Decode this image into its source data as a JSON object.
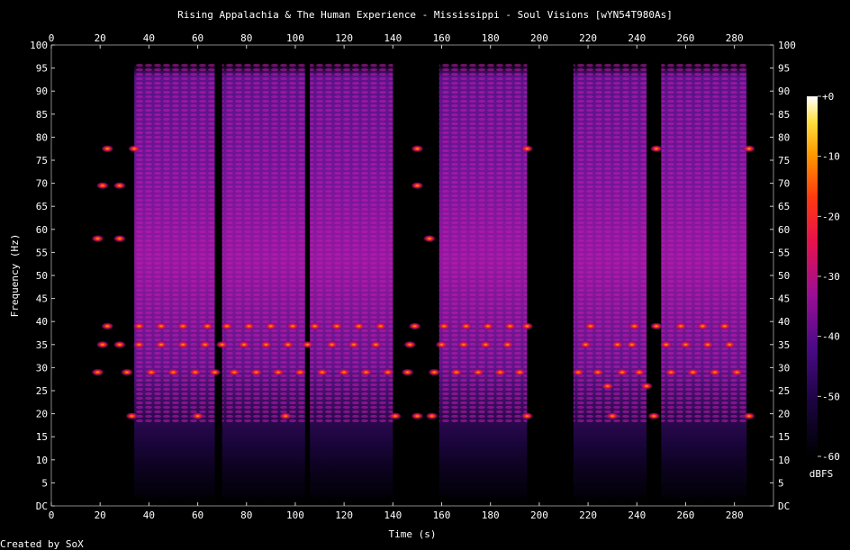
{
  "chart_data": {
    "type": "heatmap",
    "title": "Rising Appalachia & The Human Experience - Mississippi - Soul Visions [wYN54T980As]",
    "xlabel": "Time (s)",
    "ylabel": "Frequency (Hz)",
    "xlim": [
      0,
      296
    ],
    "ylim": [
      0,
      100
    ],
    "x_ticks": [
      "0",
      "20",
      "40",
      "60",
      "80",
      "100",
      "120",
      "140",
      "160",
      "180",
      "200",
      "220",
      "240",
      "260",
      "280"
    ],
    "y_ticks": [
      "DC",
      "5",
      "10",
      "15",
      "20",
      "25",
      "30",
      "35",
      "40",
      "45",
      "50",
      "55",
      "60",
      "65",
      "70",
      "75",
      "80",
      "85",
      "90",
      "95",
      "100"
    ],
    "colorbar": {
      "label": "dBFS",
      "ticks": [
        "+0",
        "-10",
        "-20",
        "-30",
        "-40",
        "-50",
        "-60"
      ],
      "range": [
        -60,
        0
      ]
    },
    "footer": "Created by SoX",
    "dense_segments": [
      [
        34,
        67
      ],
      [
        70,
        104
      ],
      [
        106,
        140
      ],
      [
        159,
        195
      ],
      [
        214,
        244
      ],
      [
        250,
        285
      ]
    ],
    "tone_events": [
      {
        "t": 19,
        "f": 29
      },
      {
        "t": 21,
        "f": 35
      },
      {
        "t": 23,
        "f": 39
      },
      {
        "t": 23,
        "f": 77.5
      },
      {
        "t": 21,
        "f": 69.5
      },
      {
        "t": 19,
        "f": 58
      },
      {
        "t": 28,
        "f": 35
      },
      {
        "t": 28,
        "f": 69.5
      },
      {
        "t": 28,
        "f": 58
      },
      {
        "t": 31,
        "f": 29
      },
      {
        "t": 33,
        "f": 19.5
      },
      {
        "t": 34,
        "f": 77.5
      },
      {
        "t": 36,
        "f": 35
      },
      {
        "t": 36,
        "f": 39
      },
      {
        "t": 41,
        "f": 29
      },
      {
        "t": 45,
        "f": 35
      },
      {
        "t": 45,
        "f": 39
      },
      {
        "t": 50,
        "f": 29
      },
      {
        "t": 54,
        "f": 35
      },
      {
        "t": 54,
        "f": 39
      },
      {
        "t": 59,
        "f": 29
      },
      {
        "t": 60,
        "f": 19.5
      },
      {
        "t": 63,
        "f": 35
      },
      {
        "t": 64,
        "f": 39
      },
      {
        "t": 67,
        "f": 29
      },
      {
        "t": 70,
        "f": 35
      },
      {
        "t": 72,
        "f": 39
      },
      {
        "t": 75,
        "f": 29
      },
      {
        "t": 79,
        "f": 35
      },
      {
        "t": 81,
        "f": 39
      },
      {
        "t": 84,
        "f": 29
      },
      {
        "t": 88,
        "f": 35
      },
      {
        "t": 90,
        "f": 39
      },
      {
        "t": 93,
        "f": 29
      },
      {
        "t": 96,
        "f": 19.5
      },
      {
        "t": 97,
        "f": 35
      },
      {
        "t": 99,
        "f": 39
      },
      {
        "t": 102,
        "f": 29
      },
      {
        "t": 105,
        "f": 35
      },
      {
        "t": 108,
        "f": 39
      },
      {
        "t": 111,
        "f": 29
      },
      {
        "t": 115,
        "f": 35
      },
      {
        "t": 117,
        "f": 39
      },
      {
        "t": 120,
        "f": 29
      },
      {
        "t": 124,
        "f": 35
      },
      {
        "t": 126,
        "f": 39
      },
      {
        "t": 129,
        "f": 29
      },
      {
        "t": 133,
        "f": 35
      },
      {
        "t": 135,
        "f": 39
      },
      {
        "t": 138,
        "f": 29
      },
      {
        "t": 141,
        "f": 19.5
      },
      {
        "t": 146,
        "f": 29
      },
      {
        "t": 147,
        "f": 35
      },
      {
        "t": 149,
        "f": 39
      },
      {
        "t": 150,
        "f": 19.5
      },
      {
        "t": 150,
        "f": 77.5
      },
      {
        "t": 150,
        "f": 69.5
      },
      {
        "t": 155,
        "f": 58
      },
      {
        "t": 156,
        "f": 19.5
      },
      {
        "t": 157,
        "f": 29
      },
      {
        "t": 160,
        "f": 35
      },
      {
        "t": 161,
        "f": 39
      },
      {
        "t": 166,
        "f": 29
      },
      {
        "t": 169,
        "f": 35
      },
      {
        "t": 170,
        "f": 39
      },
      {
        "t": 175,
        "f": 29
      },
      {
        "t": 178,
        "f": 35
      },
      {
        "t": 179,
        "f": 39
      },
      {
        "t": 184,
        "f": 29
      },
      {
        "t": 187,
        "f": 35
      },
      {
        "t": 188,
        "f": 39
      },
      {
        "t": 192,
        "f": 29
      },
      {
        "t": 195,
        "f": 19.5
      },
      {
        "t": 195,
        "f": 39
      },
      {
        "t": 195,
        "f": 77.5
      },
      {
        "t": 216,
        "f": 29
      },
      {
        "t": 219,
        "f": 35
      },
      {
        "t": 221,
        "f": 39
      },
      {
        "t": 224,
        "f": 29
      },
      {
        "t": 228,
        "f": 26
      },
      {
        "t": 230,
        "f": 19.5
      },
      {
        "t": 232,
        "f": 35
      },
      {
        "t": 234,
        "f": 29
      },
      {
        "t": 238,
        "f": 35
      },
      {
        "t": 239,
        "f": 39
      },
      {
        "t": 241,
        "f": 29
      },
      {
        "t": 244,
        "f": 26
      },
      {
        "t": 247,
        "f": 19.5
      },
      {
        "t": 248,
        "f": 39
      },
      {
        "t": 248,
        "f": 77.5
      },
      {
        "t": 252,
        "f": 35
      },
      {
        "t": 254,
        "f": 29
      },
      {
        "t": 258,
        "f": 39
      },
      {
        "t": 260,
        "f": 35
      },
      {
        "t": 263,
        "f": 29
      },
      {
        "t": 267,
        "f": 39
      },
      {
        "t": 269,
        "f": 35
      },
      {
        "t": 272,
        "f": 29
      },
      {
        "t": 276,
        "f": 39
      },
      {
        "t": 278,
        "f": 35
      },
      {
        "t": 281,
        "f": 29
      },
      {
        "t": 286,
        "f": 19.5
      },
      {
        "t": 286,
        "f": 77.5
      }
    ]
  }
}
